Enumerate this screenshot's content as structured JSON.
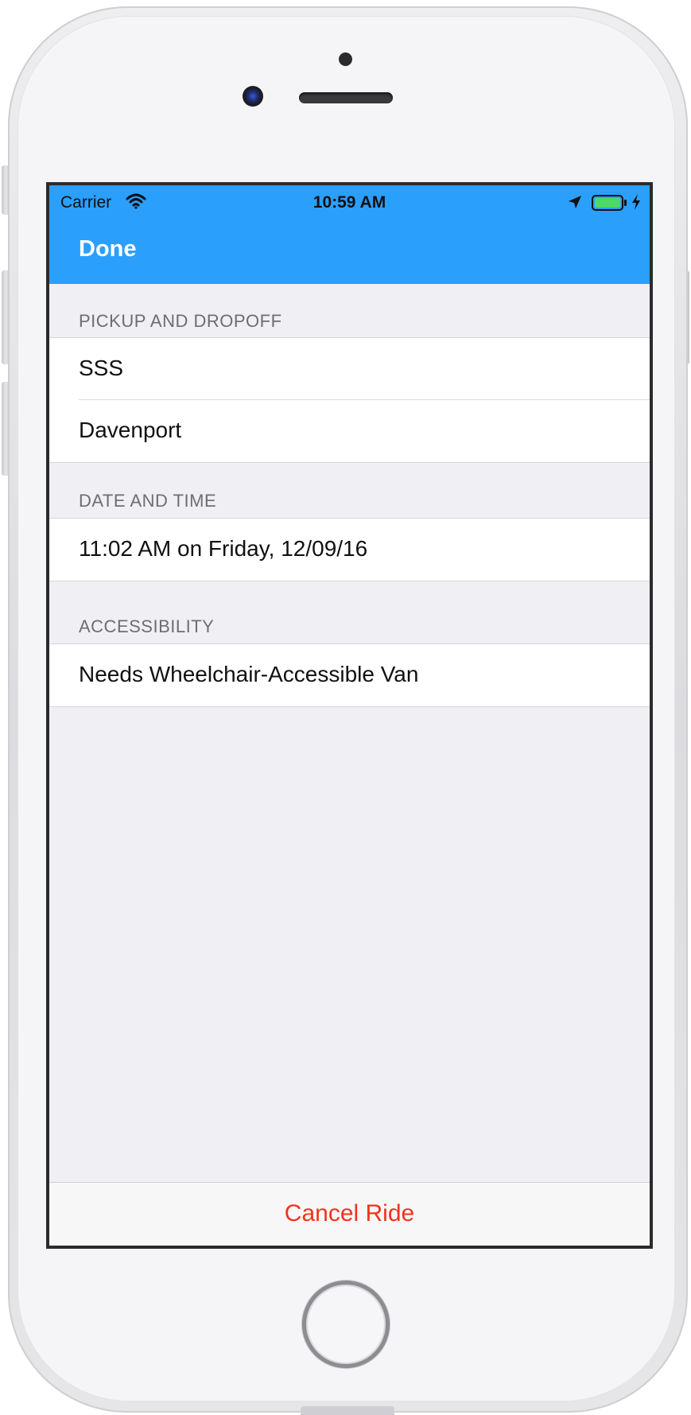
{
  "status_bar": {
    "carrier": "Carrier",
    "time": "10:59 AM",
    "icons": [
      "wifi-icon",
      "location-arrow-icon",
      "battery-icon",
      "charging-bolt-icon"
    ],
    "battery_color": "#4cd964"
  },
  "nav_bar": {
    "done_label": "Done",
    "background_color": "#2b9ffc"
  },
  "sections": {
    "pickup": {
      "header": "PICKUP AND DROPOFF",
      "rows": [
        "SSS",
        "Davenport"
      ]
    },
    "datetime": {
      "header": "DATE AND TIME",
      "rows": [
        "11:02 AM on Friday, 12/09/16"
      ]
    },
    "accessibility": {
      "header": "ACCESSIBILITY",
      "rows": [
        "Needs Wheelchair-Accessible Van"
      ]
    }
  },
  "toolbar": {
    "cancel_label": "Cancel Ride",
    "cancel_color": "#f0341c"
  }
}
